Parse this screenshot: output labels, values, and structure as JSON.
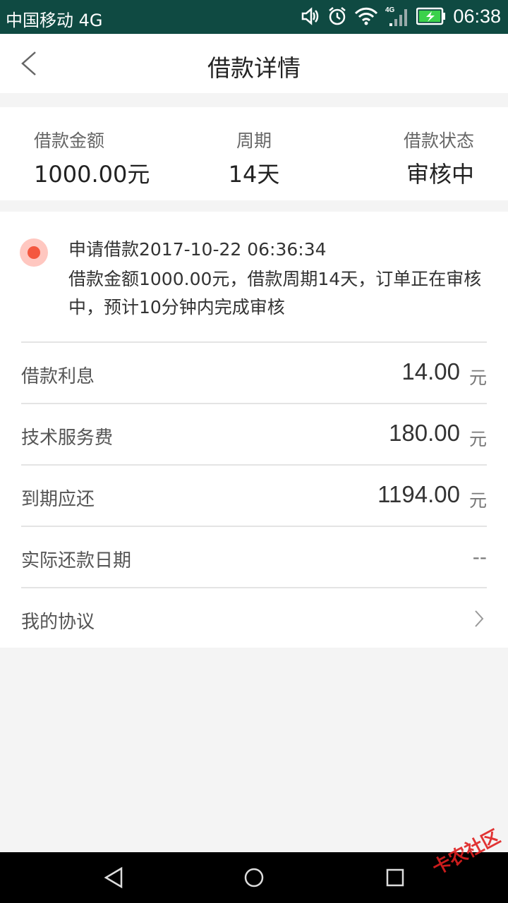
{
  "status_bar": {
    "carrier": "中国移动 4G",
    "network": "4G",
    "time": "06:38"
  },
  "header": {
    "title": "借款详情",
    "back_icon": "chevron-left-icon"
  },
  "summary": {
    "amount_label": "借款金额",
    "amount_value": "1000.00元",
    "period_label": "周期",
    "period_value": "14天",
    "status_label": "借款状态",
    "status_value": "审核中"
  },
  "timeline": {
    "dot_color": "#f4573f",
    "heading": "申请借款2017-10-22 06:36:34",
    "description": "借款金额1000.00元，借款周期14天，订单正在审核中，预计10分钟内完成审核"
  },
  "details": {
    "interest_label": "借款利息",
    "interest_value": "14.00",
    "service_fee_label": "技术服务费",
    "service_fee_value": "180.00",
    "due_label": "到期应还",
    "due_value": "1194.00",
    "unit": "元",
    "repay_date_label": "实际还款日期",
    "repay_date_value": "--",
    "agreement_label": "我的协议"
  },
  "nav": {
    "back": "triangle-back-icon",
    "home": "circle-home-icon",
    "recent": "square-recent-icon"
  },
  "watermark": "卡农社区"
}
